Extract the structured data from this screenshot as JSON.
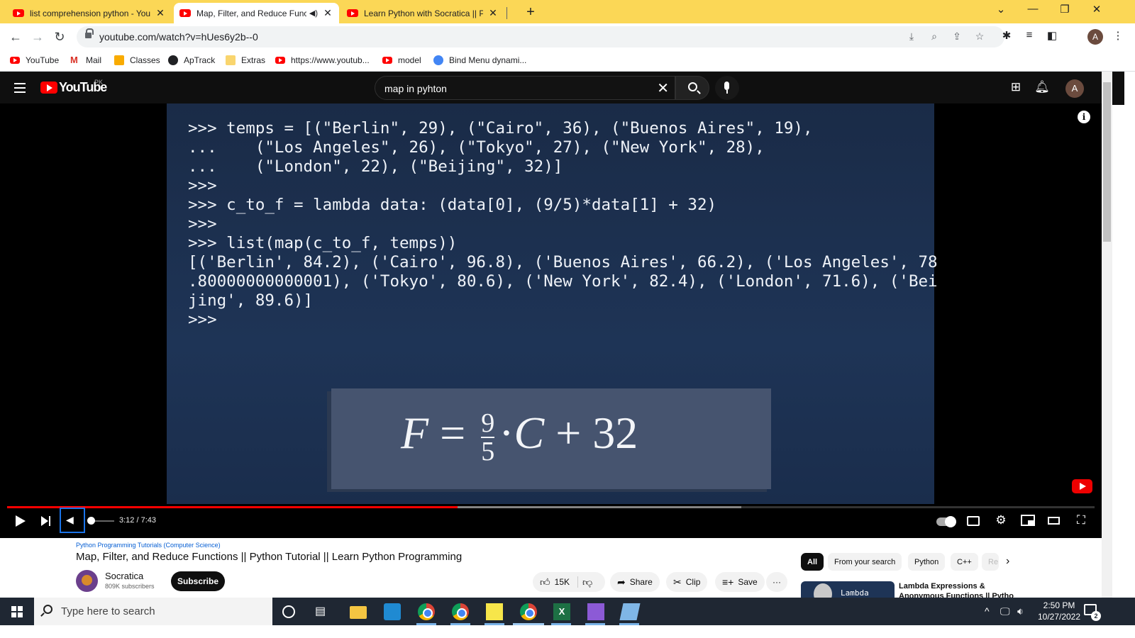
{
  "browser": {
    "tabs": [
      {
        "title": "list comprehension python - You",
        "active": false
      },
      {
        "title": "Map, Filter, and Reduce Func",
        "active": true
      },
      {
        "title": "Learn Python with Socratica || Py",
        "active": false
      }
    ],
    "url": "youtube.com/watch?v=hUes6y2b--0",
    "profile_initial": "A"
  },
  "bookmarks": [
    {
      "label": "YouTube",
      "icon": "youtube-icon"
    },
    {
      "label": "Mail",
      "icon": "gmail-icon"
    },
    {
      "label": "Classes",
      "icon": "classroom-icon"
    },
    {
      "label": "ApTrack",
      "icon": "aptrack-icon"
    },
    {
      "label": "Extras",
      "icon": "folder-icon"
    },
    {
      "label": "https://www.youtub...",
      "icon": "youtube-icon"
    },
    {
      "label": "model",
      "icon": "youtube-icon"
    },
    {
      "label": "Bind Menu dynami...",
      "icon": "bind-icon"
    }
  ],
  "youtube": {
    "logo": "YouTube",
    "country": "PK",
    "search_query": "map in pyhton",
    "avatar_initial": "A"
  },
  "video": {
    "code_lines": [
      ">>> temps = [(\"Berlin\", 29), (\"Cairo\", 36), (\"Buenos Aires\", 19),",
      "...    (\"Los Angeles\", 26), (\"Tokyo\", 27), (\"New York\", 28),",
      "...    (\"London\", 22), (\"Beijing\", 32)]",
      ">>>",
      ">>> c_to_f = lambda data: (data[0], (9/5)*data[1] + 32)",
      ">>>",
      ">>> list(map(c_to_f, temps))",
      "[('Berlin', 84.2), ('Cairo', 96.8), ('Buenos Aires', 66.2), ('Los Angeles', 78",
      ".80000000000001), ('Tokyo', 80.6), ('New York', 82.4), ('London', 71.6), ('Bei",
      "jing', 89.6)]",
      ">>>"
    ],
    "formula": {
      "lhs": "F",
      "eq": "=",
      "num": "9",
      "den": "5",
      "dot": "·",
      "var": "C",
      "plus": "+",
      "const": "32"
    },
    "time_display": "3:12 / 7:43",
    "progress_fraction": 0.414,
    "buffered_fraction": 0.675,
    "volume_fraction": 0.15
  },
  "details": {
    "channel_link": "Python Programming Tutorials (Computer Science)",
    "title": "Map, Filter, and Reduce Functions || Python Tutorial || Learn Python Programming",
    "channel_name": "Socratica",
    "subscribers": "809K subscribers",
    "subscribe_label": "Subscribe",
    "likes": "15K",
    "share_label": "Share",
    "clip_label": "Clip",
    "save_label": "Save",
    "more_label": "···"
  },
  "chips": [
    {
      "label": "All",
      "active": true
    },
    {
      "label": "From your search",
      "active": false
    },
    {
      "label": "Python",
      "active": false
    },
    {
      "label": "C++",
      "active": false
    },
    {
      "label": "Re",
      "active": false
    }
  ],
  "related": {
    "thumb_label": "Lambda",
    "title_line1": "Lambda Expressions &",
    "title_line2": "Anonymous Functions || Pytho"
  },
  "taskbar": {
    "search_placeholder": "Type here to search",
    "time": "2:50 PM",
    "date": "10/27/2022",
    "notification_count": "2"
  }
}
